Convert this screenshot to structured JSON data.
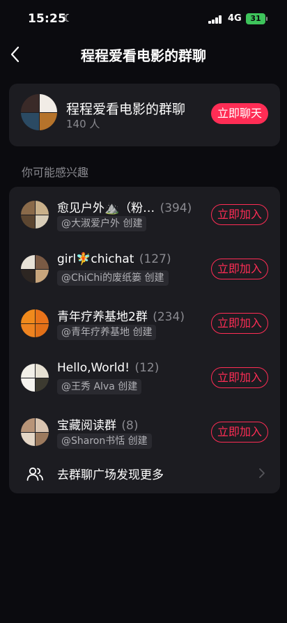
{
  "status_bar": {
    "time": "15:25",
    "network": "4G",
    "battery": "31",
    "icons": [
      "moon-icon",
      "signal-icon",
      "battery-icon"
    ]
  },
  "nav": {
    "title": "程程爱看电影的群聊",
    "back_icon": "chevron-left-icon"
  },
  "main_group": {
    "name": "程程爱看电影的群聊",
    "members": "140 人",
    "chat_button": "立即聊天"
  },
  "suggestions": {
    "section_label": "你可能感兴趣",
    "join_label": "立即加入",
    "groups": [
      {
        "name": "愈见户外⛰️（粉…",
        "count": "(394)",
        "creator": "@大淑爱户外 创建"
      },
      {
        "name": "girl🧚chichat",
        "count": "(127)",
        "creator": "@ChiChi的废纸篓 创建"
      },
      {
        "name": "青年疗养基地2群",
        "count": "(234)",
        "creator": "@青年疗养基地 创建"
      },
      {
        "name": "Hello,World!",
        "count": "(12)",
        "creator": "@王秀 Alva 创建"
      },
      {
        "name": "宝藏阅读群",
        "count": "(8)",
        "creator": "@Sharon书恬 创建"
      }
    ],
    "more_label": "去群聊广场发现更多"
  },
  "colors": {
    "background": "#0b0b0f",
    "card": "#1c1c21",
    "accent": "#ff2d55",
    "muted": "#8a8a90"
  }
}
